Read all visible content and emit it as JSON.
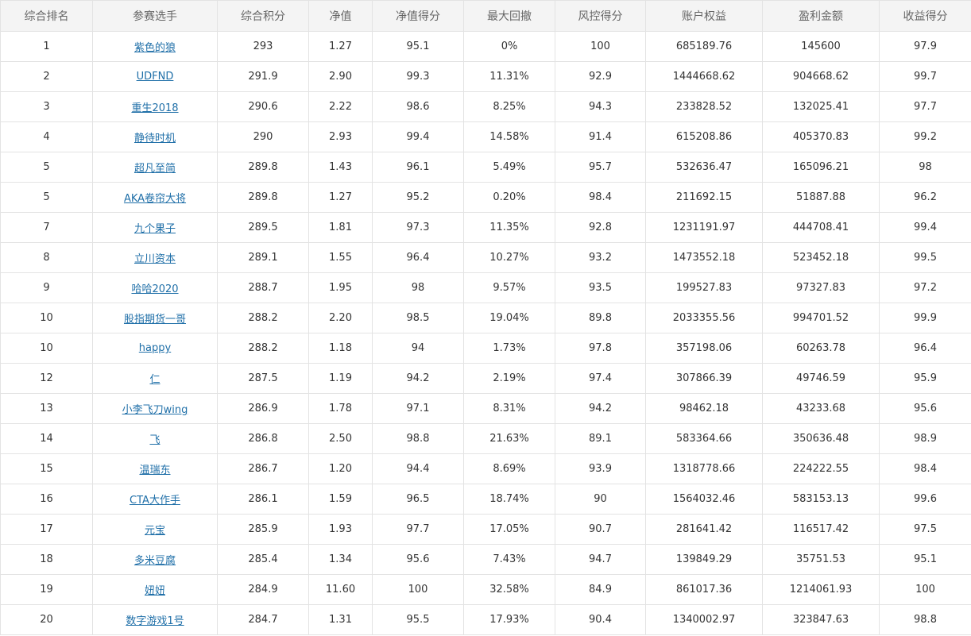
{
  "table": {
    "headers": [
      "综合排名",
      "参赛选手",
      "综合积分",
      "净值",
      "净值得分",
      "最大回撤",
      "风控得分",
      "账户权益",
      "盈利金额",
      "收益得分"
    ],
    "rows": [
      [
        "1",
        "紫色的狼",
        "293",
        "1.27",
        "95.1",
        "0%",
        "100",
        "685189.76",
        "145600",
        "97.9"
      ],
      [
        "2",
        "UDFND",
        "291.9",
        "2.90",
        "99.3",
        "11.31%",
        "92.9",
        "1444668.62",
        "904668.62",
        "99.7"
      ],
      [
        "3",
        "重生2018",
        "290.6",
        "2.22",
        "98.6",
        "8.25%",
        "94.3",
        "233828.52",
        "132025.41",
        "97.7"
      ],
      [
        "4",
        "静待时机",
        "290",
        "2.93",
        "99.4",
        "14.58%",
        "91.4",
        "615208.86",
        "405370.83",
        "99.2"
      ],
      [
        "5",
        "超凡至简",
        "289.8",
        "1.43",
        "96.1",
        "5.49%",
        "95.7",
        "532636.47",
        "165096.21",
        "98"
      ],
      [
        "5",
        "AKA卷帘大将",
        "289.8",
        "1.27",
        "95.2",
        "0.20%",
        "98.4",
        "211692.15",
        "51887.88",
        "96.2"
      ],
      [
        "7",
        "九个果子",
        "289.5",
        "1.81",
        "97.3",
        "11.35%",
        "92.8",
        "1231191.97",
        "444708.41",
        "99.4"
      ],
      [
        "8",
        "立川资本",
        "289.1",
        "1.55",
        "96.4",
        "10.27%",
        "93.2",
        "1473552.18",
        "523452.18",
        "99.5"
      ],
      [
        "9",
        "哈哈2020",
        "288.7",
        "1.95",
        "98",
        "9.57%",
        "93.5",
        "199527.83",
        "97327.83",
        "97.2"
      ],
      [
        "10",
        "股指期货一哥",
        "288.2",
        "2.20",
        "98.5",
        "19.04%",
        "89.8",
        "2033355.56",
        "994701.52",
        "99.9"
      ],
      [
        "10",
        "happy",
        "288.2",
        "1.18",
        "94",
        "1.73%",
        "97.8",
        "357198.06",
        "60263.78",
        "96.4"
      ],
      [
        "12",
        "仁",
        "287.5",
        "1.19",
        "94.2",
        "2.19%",
        "97.4",
        "307866.39",
        "49746.59",
        "95.9"
      ],
      [
        "13",
        "小李飞刀wing",
        "286.9",
        "1.78",
        "97.1",
        "8.31%",
        "94.2",
        "98462.18",
        "43233.68",
        "95.6"
      ],
      [
        "14",
        "飞",
        "286.8",
        "2.50",
        "98.8",
        "21.63%",
        "89.1",
        "583364.66",
        "350636.48",
        "98.9"
      ],
      [
        "15",
        "温瑞东",
        "286.7",
        "1.20",
        "94.4",
        "8.69%",
        "93.9",
        "1318778.66",
        "224222.55",
        "98.4"
      ],
      [
        "16",
        "CTA大作手",
        "286.1",
        "1.59",
        "96.5",
        "18.74%",
        "90",
        "1564032.46",
        "583153.13",
        "99.6"
      ],
      [
        "17",
        "元宝",
        "285.9",
        "1.93",
        "97.7",
        "17.05%",
        "90.7",
        "281641.42",
        "116517.42",
        "97.5"
      ],
      [
        "18",
        "多米豆腐",
        "285.4",
        "1.34",
        "95.6",
        "7.43%",
        "94.7",
        "139849.29",
        "35751.53",
        "95.1"
      ],
      [
        "19",
        "妞妞",
        "284.9",
        "11.60",
        "100",
        "32.58%",
        "84.9",
        "861017.36",
        "1214061.93",
        "100"
      ],
      [
        "20",
        "数字游戏1号",
        "284.7",
        "1.31",
        "95.5",
        "17.93%",
        "90.4",
        "1340002.97",
        "323847.63",
        "98.8"
      ]
    ]
  },
  "colors": {
    "header_bg": "#f4f4f4",
    "border": "#e3e3e3",
    "link": "#1f6fa8",
    "text": "#333333"
  }
}
